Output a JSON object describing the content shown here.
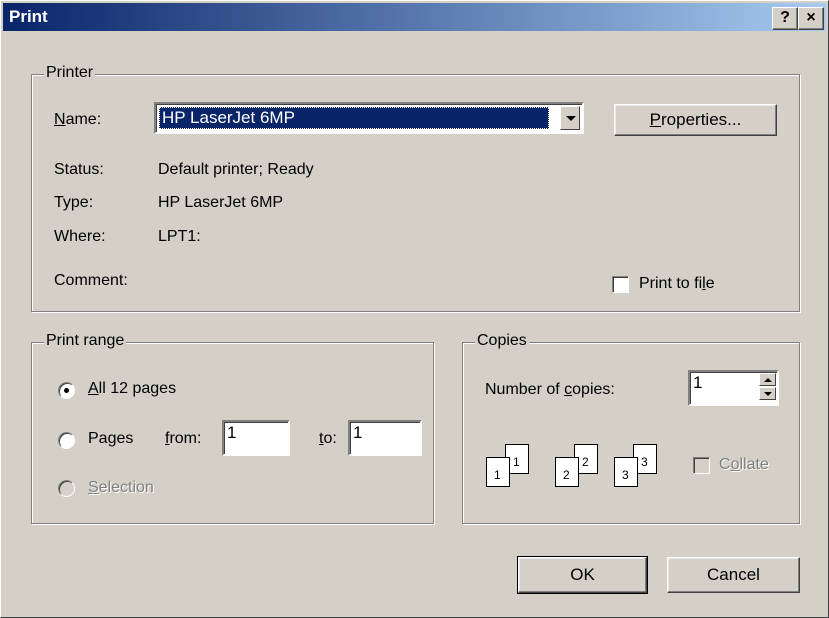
{
  "window": {
    "title": "Print",
    "help_button": "?",
    "close_button": "×"
  },
  "printer": {
    "group_label": "Printer",
    "name_label": "Name:",
    "name_label_mnemonic": "N",
    "name_label_rest": "ame:",
    "selected_printer": "HP LaserJet 6MP",
    "properties_mnemonic": "P",
    "properties_rest": "roperties...",
    "status_label": "Status:",
    "status_value": "Default printer; Ready",
    "type_label": "Type:",
    "type_value": "HP LaserJet 6MP",
    "where_label": "Where:",
    "where_value": "LPT1:",
    "comment_label": "Comment:",
    "print_to_file_before": "Print to fi",
    "print_to_file_mnemonic": "l",
    "print_to_file_after": "e",
    "print_to_file_checked": false
  },
  "print_range": {
    "group_label": "Print range",
    "all_mnemonic": "A",
    "all_rest": "ll 12 pages",
    "pages_label": "Pages",
    "from_mnemonic": "f",
    "from_rest": "rom:",
    "from_value": "1",
    "to_mnemonic": "t",
    "to_rest": "o:",
    "to_value": "1",
    "selection_mnemonic": "S",
    "selection_rest": "election",
    "selected": "all"
  },
  "copies": {
    "group_label": "Copies",
    "number_label_before": "Number of ",
    "number_label_mnemonic": "c",
    "number_label_after": "opies:",
    "number_value": "1",
    "collate_before": "C",
    "collate_mnemonic": "o",
    "collate_after": "llate",
    "collate_checked": false,
    "collate_pages": [
      {
        "back": "1",
        "front": "1"
      },
      {
        "back": "2",
        "front": "2"
      },
      {
        "back": "3",
        "front": "3"
      }
    ]
  },
  "buttons": {
    "ok": "OK",
    "cancel": "Cancel"
  }
}
